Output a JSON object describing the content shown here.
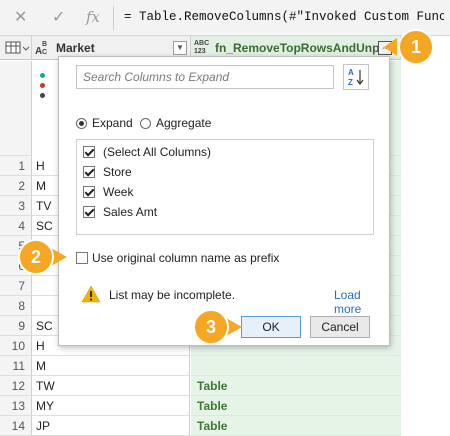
{
  "formula_bar": {
    "cancel_icon": "✕",
    "confirm_icon": "✓",
    "fx_icon": "fx",
    "formula": "= Table.RemoveColumns(#\"Invoked Custom Functio"
  },
  "columns": {
    "market": {
      "type_top": "A",
      "type_sup": "B",
      "type_sub": "C",
      "label": "Market"
    },
    "fn": {
      "type_top": "ABC",
      "type_bottom": "123",
      "label": "fn_RemoveTopRowsAndUnpi..."
    }
  },
  "rows": [
    {
      "num": "1",
      "market": "H",
      "fn": ""
    },
    {
      "num": "2",
      "market": "M",
      "fn": ""
    },
    {
      "num": "3",
      "market": "TV",
      "fn": ""
    },
    {
      "num": "4",
      "market": "SC",
      "fn": ""
    },
    {
      "num": "5",
      "market": "M",
      "fn": ""
    },
    {
      "num": "6",
      "market": "H",
      "fn": ""
    },
    {
      "num": "7",
      "market": "",
      "fn": ""
    },
    {
      "num": "8",
      "market": "",
      "fn": ""
    },
    {
      "num": "9",
      "market": "SC",
      "fn": ""
    },
    {
      "num": "10",
      "market": "H",
      "fn": ""
    },
    {
      "num": "11",
      "market": "M",
      "fn": ""
    },
    {
      "num": "12",
      "market": "TW",
      "fn": "Table"
    },
    {
      "num": "13",
      "market": "MY",
      "fn": "Table"
    },
    {
      "num": "14",
      "market": "JP",
      "fn": "Table"
    }
  ],
  "popup": {
    "search_placeholder": "Search Columns to Expand",
    "sort_icon": "A↓Z",
    "expand_label": "Expand",
    "aggregate_label": "Aggregate",
    "columns": [
      {
        "label": "(Select All Columns)",
        "checked": true
      },
      {
        "label": "Store",
        "checked": true
      },
      {
        "label": "Week",
        "checked": true
      },
      {
        "label": "Sales Amt",
        "checked": true
      }
    ],
    "prefix_label": "Use original column name as prefix",
    "warning_text": "List may be incomplete.",
    "load_more": "Load more",
    "ok_label": "OK",
    "cancel_label": "Cancel"
  },
  "callouts": [
    "1",
    "2",
    "3"
  ],
  "colors": {
    "accent": "#f5a623",
    "table_green": "#3b7a2f",
    "link": "#1f6fc2"
  }
}
